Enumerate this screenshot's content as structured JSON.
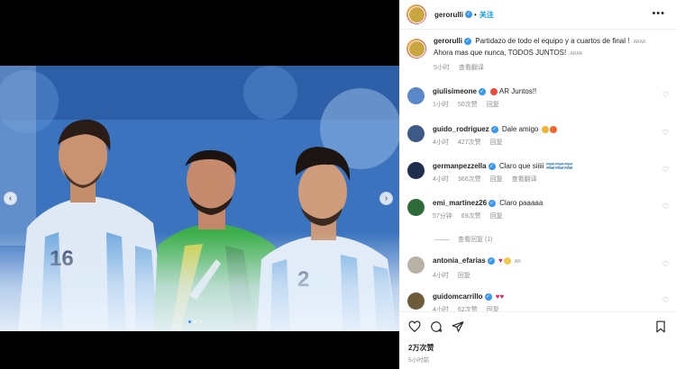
{
  "post": {
    "author": "gerorulli",
    "follow_label": "关注",
    "more_label": "•••",
    "media_dots": 3,
    "active_dot": 0
  },
  "caption": {
    "author": "gerorulli",
    "text": "Partidazo de todo el equipo y a cuartos de final ! ",
    "tag1": "ARAR",
    "text2": "Ahora mas que nunca, TODOS JUNTOS! ",
    "tag2": "ARAR",
    "time": "5小时",
    "translate": "查看翻译"
  },
  "comments": [
    {
      "user": "giulisimeone",
      "verified": true,
      "text": "AR Juntos!!",
      "time": "1小时",
      "likes": "50次赞",
      "action": "回复",
      "avatar_color": "#5a87c7"
    },
    {
      "user": "guido_rodriguez",
      "verified": true,
      "text": "Dale amigo ",
      "time": "4小时",
      "likes": "427次赞",
      "action": "回复",
      "avatar_color": "#3d5a86"
    },
    {
      "user": "germanpezzella",
      "verified": true,
      "text": "Claro que siiiii 🇦🇷🇦🇷🇦🇷",
      "time": "4小时",
      "likes": "366次赞",
      "action": "回复",
      "extra": "查看翻译",
      "avatar_color": "#1e2c4d"
    },
    {
      "user": "emi_martinez26",
      "verified": true,
      "text": "Claro paaaaa",
      "time": "57分钟",
      "likes": "69次赞",
      "action": "回复",
      "avatar_color": "#2e6b3a"
    },
    {
      "user": "antonia_efarias",
      "verified": true,
      "text": "AR",
      "time": "4小时",
      "likes": "",
      "action": "回复",
      "avatar_color": "#b8b2a6"
    },
    {
      "user": "guidomcarrillo",
      "verified": true,
      "text": "",
      "time": "4小时",
      "likes": "62次赞",
      "action": "回复",
      "avatar_color": "#6e5b3a"
    }
  ],
  "view_replies": "查看回复 (1)",
  "stats": {
    "likes": "2万次赞",
    "time": "5小时前"
  },
  "icons": [
    "heart-icon",
    "comment-icon",
    "share-icon",
    "bookmark-icon"
  ],
  "colors": {
    "verified": "#3897f0",
    "follow": "#0095f6",
    "muted": "#8e8e8e"
  }
}
